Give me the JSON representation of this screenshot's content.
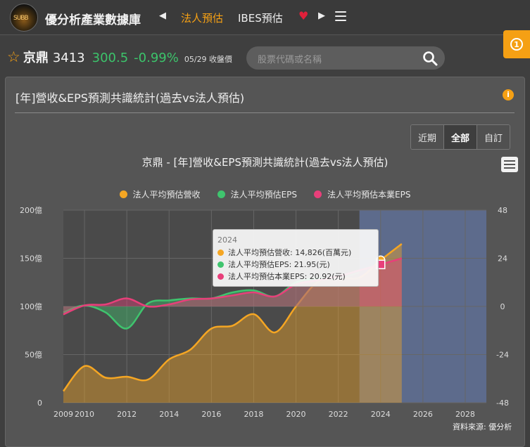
{
  "header": {
    "brand": "優分析產業數據庫",
    "logo_text": "SUBB",
    "nav": [
      "法人預估",
      "IBES預估"
    ],
    "active_nav": "法人預估",
    "badge": "1"
  },
  "stock": {
    "name": "京鼎",
    "code": "3413",
    "price": "300.5",
    "change": "-0.99%",
    "date": "05/29 收盤價"
  },
  "search": {
    "placeholder": "股票代碼或名稱"
  },
  "panel": {
    "title": "[年]營收&EPS預測共識統計(過去vs法人預估)",
    "range_buttons": [
      "近期",
      "全部",
      "自訂"
    ],
    "active_range": "全部",
    "source": "資料來源: 優分析"
  },
  "chart_data": {
    "type": "area",
    "title": "京鼎 - [年]營收&EPS預測共識統計(過去vs法人預估)",
    "series": [
      {
        "name": "法人平均預估營收",
        "color": "#f5a623",
        "axis": "left",
        "x": [
          2009,
          2010,
          2011,
          2012,
          2013,
          2014,
          2015,
          2016,
          2017,
          2018,
          2019,
          2020,
          2021,
          2022,
          2023,
          2024,
          2025
        ],
        "values": [
          12,
          38,
          26,
          27,
          24,
          45,
          55,
          77,
          80,
          92,
          73,
          100,
          125,
          130,
          130,
          148,
          165
        ]
      },
      {
        "name": "法人平均預估EPS",
        "color": "#3fc46e",
        "axis": "right",
        "x": [
          2009,
          2010,
          2011,
          2012,
          2013,
          2014,
          2015,
          2016,
          2017,
          2018,
          2019,
          2020,
          2021,
          2022,
          2023
        ],
        "values": [
          -3,
          0.5,
          -3,
          -11,
          1.5,
          3,
          4,
          4,
          7,
          8,
          5,
          12,
          14,
          14,
          17
        ]
      },
      {
        "name": "法人平均預估本業EPS",
        "color": "#e83f7a",
        "axis": "right",
        "x": [
          2009,
          2010,
          2011,
          2012,
          2013,
          2014,
          2015,
          2016,
          2017,
          2018,
          2019,
          2020,
          2021,
          2022,
          2023,
          2024,
          2025
        ],
        "values": [
          -4,
          0.5,
          1,
          4,
          0,
          1,
          3.5,
          4,
          5.5,
          7,
          5,
          11,
          13,
          15,
          18,
          20.92,
          24
        ]
      }
    ],
    "y_left": {
      "ticks": [
        "0",
        "50億",
        "100億",
        "150億",
        "200億"
      ],
      "range": [
        0,
        200
      ]
    },
    "y_right": {
      "ticks": [
        "-48",
        "-24",
        "0",
        "24",
        "48"
      ],
      "range": [
        -48,
        48
      ]
    },
    "x_ticks": [
      "2009",
      "2010",
      "2012",
      "2014",
      "2016",
      "2018",
      "2020",
      "2022",
      "2024",
      "2026",
      "2028"
    ],
    "x_range": [
      2009,
      2029
    ],
    "forecast_band": [
      2023,
      2029
    ],
    "highlight": {
      "x": 2024
    },
    "grid": true,
    "legend_position": "top"
  },
  "tooltip": {
    "year": "2024",
    "rows": [
      {
        "color": "#f5a623",
        "text": "法人平均預估營收: 14,826(百萬元)"
      },
      {
        "color": "#3fc46e",
        "text": "法人平均預估EPS: 21.95(元)"
      },
      {
        "color": "#e83f7a",
        "text": "法人平均預估本業EPS: 20.92(元)"
      }
    ]
  }
}
